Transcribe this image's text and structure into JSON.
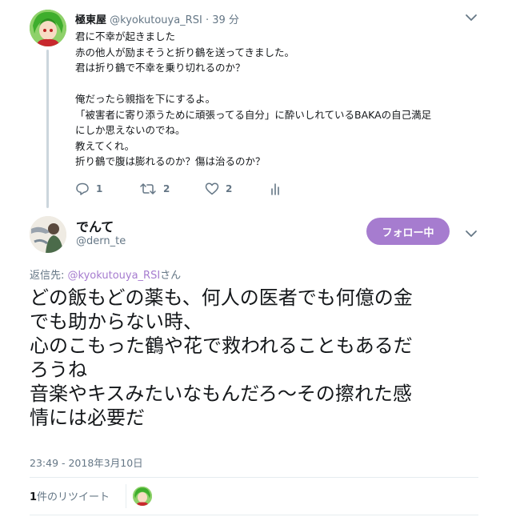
{
  "parent_tweet": {
    "display_name": "極東屋",
    "handle": "@kyokutouya_RSI",
    "separator": "·",
    "time_ago": "39 分",
    "lines": [
      "君に不幸が起きました",
      "赤の他人が励まそうと折り鶴を送ってきました。",
      "君は折り鶴で不幸を乗り切れるのか？",
      "",
      "俺だったら親指を下にするよ。",
      "「被害者に寄り添うために頑張ってる自分」に酔いしれているBAKAの自己満足",
      "にしか思えないのでね。",
      "教えてくれ。",
      "折り鶴で腹は膨れるのか？傷は治るのか？"
    ],
    "actions": {
      "reply_count": "1",
      "retweet_count": "2",
      "like_count": "2"
    },
    "icons": [
      "reply-icon",
      "retweet-icon",
      "like-icon",
      "analytics-icon",
      "chevron-down-icon"
    ]
  },
  "main_tweet": {
    "display_name": "でんて",
    "handle": "@dern_te",
    "follow_button_label": "フォロー中",
    "reply_to_prefix": "返信先: ",
    "reply_to_handle": "@kyokutouya_RSI",
    "reply_to_suffix": "さん",
    "lines": [
      "どの飯もどの薬も、何人の医者でも何億の金",
      "でも助からない時、",
      "心のこもった鶴や花で救われることもあるだ",
      "ろうね",
      "音楽やキスみたいなもんだろ〜その擦れた感",
      "情には必要だ"
    ],
    "timestamp": "23:49 - 2018年3月10日",
    "retweets": {
      "count": "1",
      "label": "件のリツイート"
    }
  },
  "colors": {
    "accent": "#a67ccf",
    "secondary_text": "#657786",
    "divider": "#e6ecf0",
    "thread_line": "#ccd6dd"
  }
}
